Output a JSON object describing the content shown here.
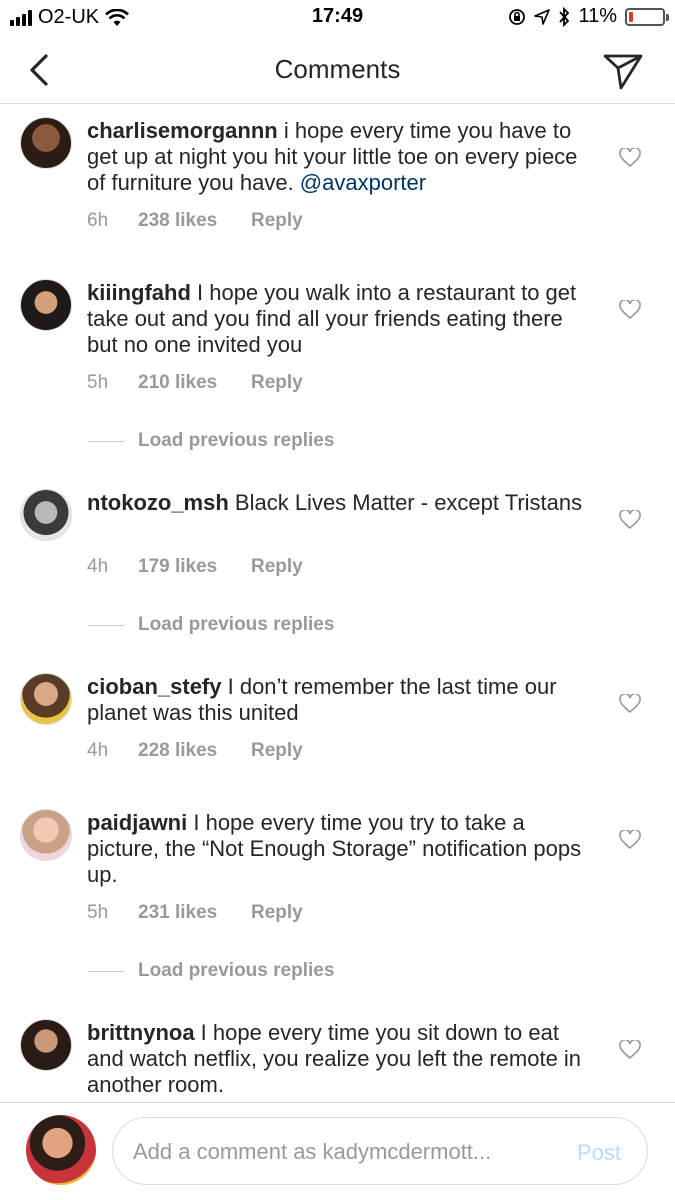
{
  "status_bar": {
    "carrier": "O2-UK",
    "time": "17:49",
    "battery": "11%",
    "battery_level": 0.11,
    "icons": [
      "signal-icon",
      "wifi-icon",
      "orientation-lock-icon",
      "location-icon",
      "bluetooth-icon",
      "battery-icon"
    ]
  },
  "header": {
    "title": "Comments",
    "back_icon": "chevron-left-icon",
    "send_icon": "direct-send-icon"
  },
  "comments": [
    {
      "username": "charlisemorgannn",
      "text": " i hope every time you have to get up at night you hit your little toe on every piece of furniture you have. ",
      "mention": "@avaxporter",
      "time": "6h",
      "likes": "238 likes",
      "reply": "Reply"
    },
    {
      "username": "kiiingfahd",
      "text": " I hope you walk into a restaurant to get take out and you find all your friends eating there but no one invited you",
      "time": "5h",
      "likes": "210 likes",
      "reply": "Reply"
    },
    {
      "username": "ntokozo_msh",
      "text": " Black Lives Matter - except Tristans",
      "time": "4h",
      "likes": "179 likes",
      "reply": "Reply"
    },
    {
      "username": "cioban_stefy",
      "text": " I don’t remember the last time our planet was this united",
      "time": "4h",
      "likes": "228 likes",
      "reply": "Reply"
    },
    {
      "username": "paidjawni",
      "text": " I hope every time you try to take a picture, the “Not Enough Storage” notification pops up.",
      "time": "5h",
      "likes": "231 likes",
      "reply": "Reply"
    },
    {
      "username": "brittnynoa",
      "text": " I hope every time you sit down to eat and watch netflix, you realize you left the remote in another room."
    }
  ],
  "load_previous_label": "Load previous replies",
  "composer": {
    "placeholder": "Add a comment as kadymcdermott...",
    "post_label": "Post"
  },
  "colors": {
    "text": "#262626",
    "meta": "#999999",
    "mention": "#003569",
    "post_disabled": "#b3dbff",
    "divider": "#dbdbdb",
    "battery_low": "#e0382e"
  }
}
